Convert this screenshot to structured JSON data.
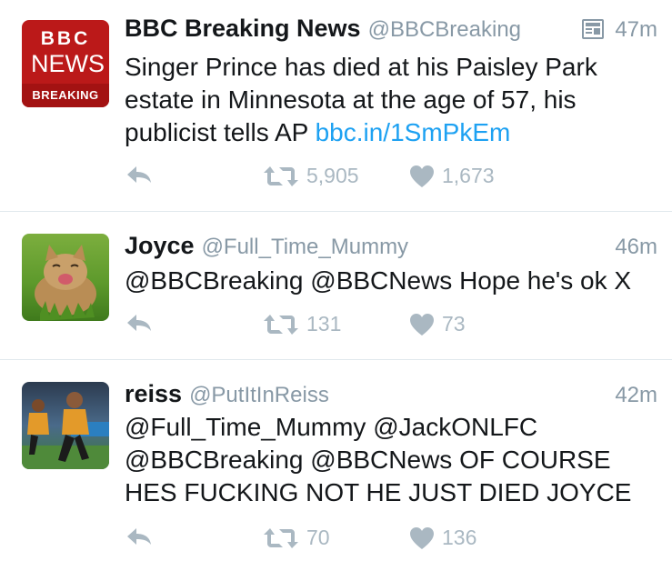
{
  "tweets": [
    {
      "name": "BBC Breaking News",
      "handle": "@BBCBreaking",
      "time": "47m",
      "avatar": {
        "line1": "BBC",
        "line2": "NEWS",
        "line3": "BREAKING",
        "bg": "#bb1919"
      },
      "text_lines": [
        "Singer Prince has died at his Paisley Park",
        "estate in Minnesota at the age of 57, his",
        "publicist tells AP"
      ],
      "link": "bbc.in/1SmPkEm",
      "retweets": "5,905",
      "likes": "1,673"
    },
    {
      "name": "Joyce",
      "handle": "@Full_Time_Mummy",
      "time": "46m",
      "text_lines": [
        "@BBCBreaking @BBCNews Hope he's ok X"
      ],
      "retweets": "131",
      "likes": "73"
    },
    {
      "name": "reiss",
      "handle": "@PutItInReiss",
      "time": "42m",
      "text_lines": [
        "@Full_Time_Mummy @JackONLFC",
        "@BBCBreaking @BBCNews OF COURSE",
        "HES FUCKING NOT HE JUST DIED JOYCE"
      ],
      "retweets": "70",
      "likes": "136"
    }
  ],
  "colors": {
    "muted": "#aab8c2",
    "link": "#1da1f2",
    "divider": "#e1e8ed"
  },
  "icons": {
    "reply": "reply-icon",
    "retweet": "retweet-icon",
    "like": "heart-icon",
    "card": "summary-card-icon"
  }
}
